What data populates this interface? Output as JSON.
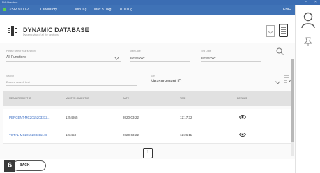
{
  "window": {
    "title": "NAV-bar test"
  },
  "status": {
    "model": "XSIP 9000-2",
    "location": "Laboratory 1",
    "min": "Min 0 g",
    "max": "Max 3.0 kg",
    "d": "d 0.01 g",
    "lang": "ENG"
  },
  "header": {
    "title": "DYNAMIC DATABASE",
    "subtitle": "Dynamic view of all the functions"
  },
  "filters": {
    "function_label": "Please select your function",
    "function_value": "All Functions",
    "start_label": "Start Date",
    "start_value": "dd/mm/yyyy",
    "end_label": "End Date",
    "end_value": "dd/mm/yyyy",
    "search_label": "Search",
    "search_placeholder": "Enter a search text",
    "sort_label": "Sort",
    "sort_value": "Measurement ID"
  },
  "table": {
    "columns": [
      "MEASUREMENT ID",
      "MASTER OBJECT ID",
      "DATE",
      "TIME",
      "DETAILS"
    ],
    "rows": [
      {
        "id": "PERCENT-MC2015203312...",
        "master": "1254865",
        "date": "2020-03-22",
        "time": "12:17:32"
      },
      {
        "id": "TOTAL-MC2015203311146",
        "master": "123453",
        "date": "2020-03-22",
        "time": "12:26:11"
      }
    ]
  },
  "pager": {
    "page": "1"
  },
  "footer": {
    "step": "6",
    "back_label": "BACK"
  }
}
